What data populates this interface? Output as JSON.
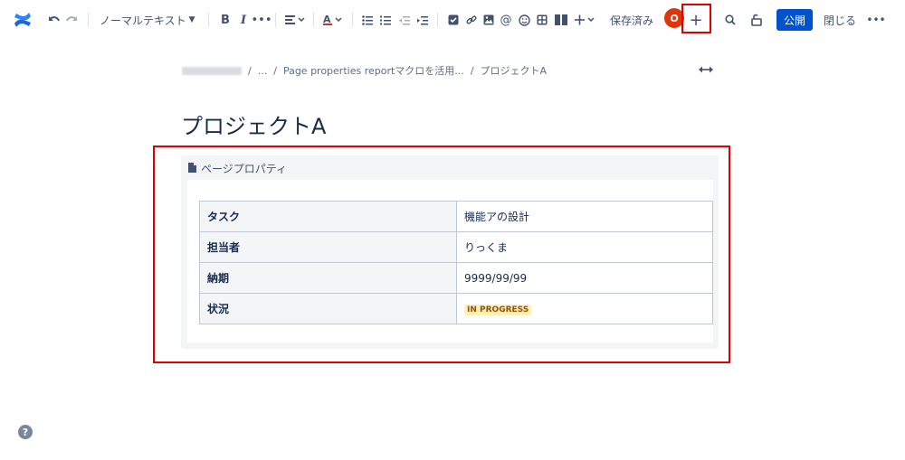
{
  "toolbar": {
    "text_style": "ノーマルテキスト",
    "bold": "B",
    "italic": "I",
    "status": "保存済み",
    "avatar_initial": "O",
    "publish": "公開",
    "close": "閉じる"
  },
  "breadcrumb": {
    "ellipsis": "...",
    "parent": "Page properties reportマクロを活用...",
    "current": "プロジェクトA"
  },
  "page": {
    "title": "プロジェクトA"
  },
  "macro": {
    "title": "ページプロパティ",
    "rows": [
      {
        "key": "タスク",
        "value": "機能アの設計"
      },
      {
        "key": "担当者",
        "value": "りっくま"
      },
      {
        "key": "納期",
        "value": "9999/99/99"
      },
      {
        "key": "状況",
        "value": "IN PROGRESS"
      }
    ]
  },
  "help": "?",
  "colors": {
    "brand": "#0052cc",
    "highlight": "#e00000",
    "avatar": "#de350b",
    "lozenge_bg": "#fff0b3",
    "lozenge_text": "#974f0c"
  }
}
